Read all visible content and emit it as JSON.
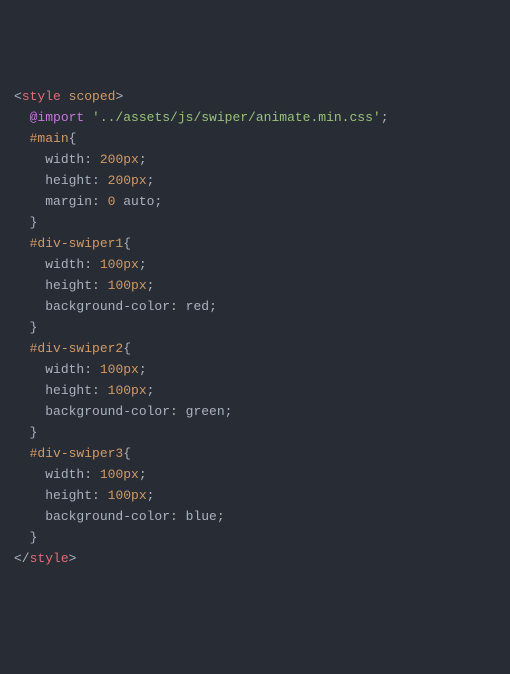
{
  "code": {
    "lines": [
      {
        "tokens": [
          {
            "t": "<",
            "c": "punct"
          },
          {
            "t": "style",
            "c": "tag-name"
          },
          {
            "t": " ",
            "c": "punct"
          },
          {
            "t": "scoped",
            "c": "attr-name"
          },
          {
            "t": ">",
            "c": "punct"
          }
        ]
      },
      {
        "tokens": [
          {
            "t": "  ",
            "c": "punct"
          },
          {
            "t": "@import",
            "c": "keyword"
          },
          {
            "t": " ",
            "c": "punct"
          },
          {
            "t": "'../assets/js/swiper/animate.min.css'",
            "c": "string"
          },
          {
            "t": ";",
            "c": "punct"
          }
        ]
      },
      {
        "tokens": [
          {
            "t": "  ",
            "c": "punct"
          },
          {
            "t": "#main",
            "c": "selector"
          },
          {
            "t": "{",
            "c": "punct"
          }
        ]
      },
      {
        "tokens": [
          {
            "t": "    ",
            "c": "punct"
          },
          {
            "t": "width",
            "c": "prop"
          },
          {
            "t": ": ",
            "c": "punct"
          },
          {
            "t": "200px",
            "c": "num"
          },
          {
            "t": ";",
            "c": "punct"
          }
        ]
      },
      {
        "tokens": [
          {
            "t": "    ",
            "c": "punct"
          },
          {
            "t": "height",
            "c": "prop"
          },
          {
            "t": ": ",
            "c": "punct"
          },
          {
            "t": "200px",
            "c": "num"
          },
          {
            "t": ";",
            "c": "punct"
          }
        ]
      },
      {
        "tokens": [
          {
            "t": "    ",
            "c": "punct"
          },
          {
            "t": "margin",
            "c": "prop"
          },
          {
            "t": ": ",
            "c": "punct"
          },
          {
            "t": "0",
            "c": "num"
          },
          {
            "t": " auto;",
            "c": "punct"
          }
        ]
      },
      {
        "tokens": [
          {
            "t": "  }",
            "c": "punct"
          }
        ]
      },
      {
        "tokens": [
          {
            "t": "  ",
            "c": "punct"
          },
          {
            "t": "#div-swiper1",
            "c": "selector"
          },
          {
            "t": "{",
            "c": "punct"
          }
        ]
      },
      {
        "tokens": [
          {
            "t": "    ",
            "c": "punct"
          },
          {
            "t": "width",
            "c": "prop"
          },
          {
            "t": ": ",
            "c": "punct"
          },
          {
            "t": "100px",
            "c": "num"
          },
          {
            "t": ";",
            "c": "punct"
          }
        ]
      },
      {
        "tokens": [
          {
            "t": "    ",
            "c": "punct"
          },
          {
            "t": "height",
            "c": "prop"
          },
          {
            "t": ": ",
            "c": "punct"
          },
          {
            "t": "100px",
            "c": "num"
          },
          {
            "t": ";",
            "c": "punct"
          }
        ]
      },
      {
        "tokens": [
          {
            "t": "    ",
            "c": "punct"
          },
          {
            "t": "background-color",
            "c": "prop"
          },
          {
            "t": ": ",
            "c": "punct"
          },
          {
            "t": "red",
            "c": "colorval"
          },
          {
            "t": ";",
            "c": "punct"
          }
        ]
      },
      {
        "tokens": [
          {
            "t": "  }",
            "c": "punct"
          }
        ]
      },
      {
        "tokens": [
          {
            "t": "  ",
            "c": "punct"
          },
          {
            "t": "#div-swiper2",
            "c": "selector"
          },
          {
            "t": "{",
            "c": "punct"
          }
        ]
      },
      {
        "tokens": [
          {
            "t": "    ",
            "c": "punct"
          },
          {
            "t": "width",
            "c": "prop"
          },
          {
            "t": ": ",
            "c": "punct"
          },
          {
            "t": "100px",
            "c": "num"
          },
          {
            "t": ";",
            "c": "punct"
          }
        ]
      },
      {
        "tokens": [
          {
            "t": "    ",
            "c": "punct"
          },
          {
            "t": "height",
            "c": "prop"
          },
          {
            "t": ": ",
            "c": "punct"
          },
          {
            "t": "100px",
            "c": "num"
          },
          {
            "t": ";",
            "c": "punct"
          }
        ]
      },
      {
        "tokens": [
          {
            "t": "    ",
            "c": "punct"
          },
          {
            "t": "background-color",
            "c": "prop"
          },
          {
            "t": ": ",
            "c": "punct"
          },
          {
            "t": "green",
            "c": "colorval"
          },
          {
            "t": ";",
            "c": "punct"
          }
        ]
      },
      {
        "tokens": [
          {
            "t": "  }",
            "c": "punct"
          }
        ]
      },
      {
        "tokens": [
          {
            "t": "  ",
            "c": "punct"
          },
          {
            "t": "#div-swiper3",
            "c": "selector"
          },
          {
            "t": "{",
            "c": "punct"
          }
        ]
      },
      {
        "tokens": [
          {
            "t": "    ",
            "c": "punct"
          },
          {
            "t": "width",
            "c": "prop"
          },
          {
            "t": ": ",
            "c": "punct"
          },
          {
            "t": "100px",
            "c": "num"
          },
          {
            "t": ";",
            "c": "punct"
          }
        ]
      },
      {
        "tokens": [
          {
            "t": "    ",
            "c": "punct"
          },
          {
            "t": "height",
            "c": "prop"
          },
          {
            "t": ": ",
            "c": "punct"
          },
          {
            "t": "100px",
            "c": "num"
          },
          {
            "t": ";",
            "c": "punct"
          }
        ]
      },
      {
        "tokens": [
          {
            "t": "    ",
            "c": "punct"
          },
          {
            "t": "background-color",
            "c": "prop"
          },
          {
            "t": ": ",
            "c": "punct"
          },
          {
            "t": "blue",
            "c": "colorval"
          },
          {
            "t": ";",
            "c": "punct"
          }
        ]
      },
      {
        "tokens": [
          {
            "t": "  }",
            "c": "punct"
          }
        ]
      },
      {
        "tokens": [
          {
            "t": "</",
            "c": "punct"
          },
          {
            "t": "style",
            "c": "tag-name"
          },
          {
            "t": ">",
            "c": "punct"
          }
        ]
      }
    ]
  }
}
